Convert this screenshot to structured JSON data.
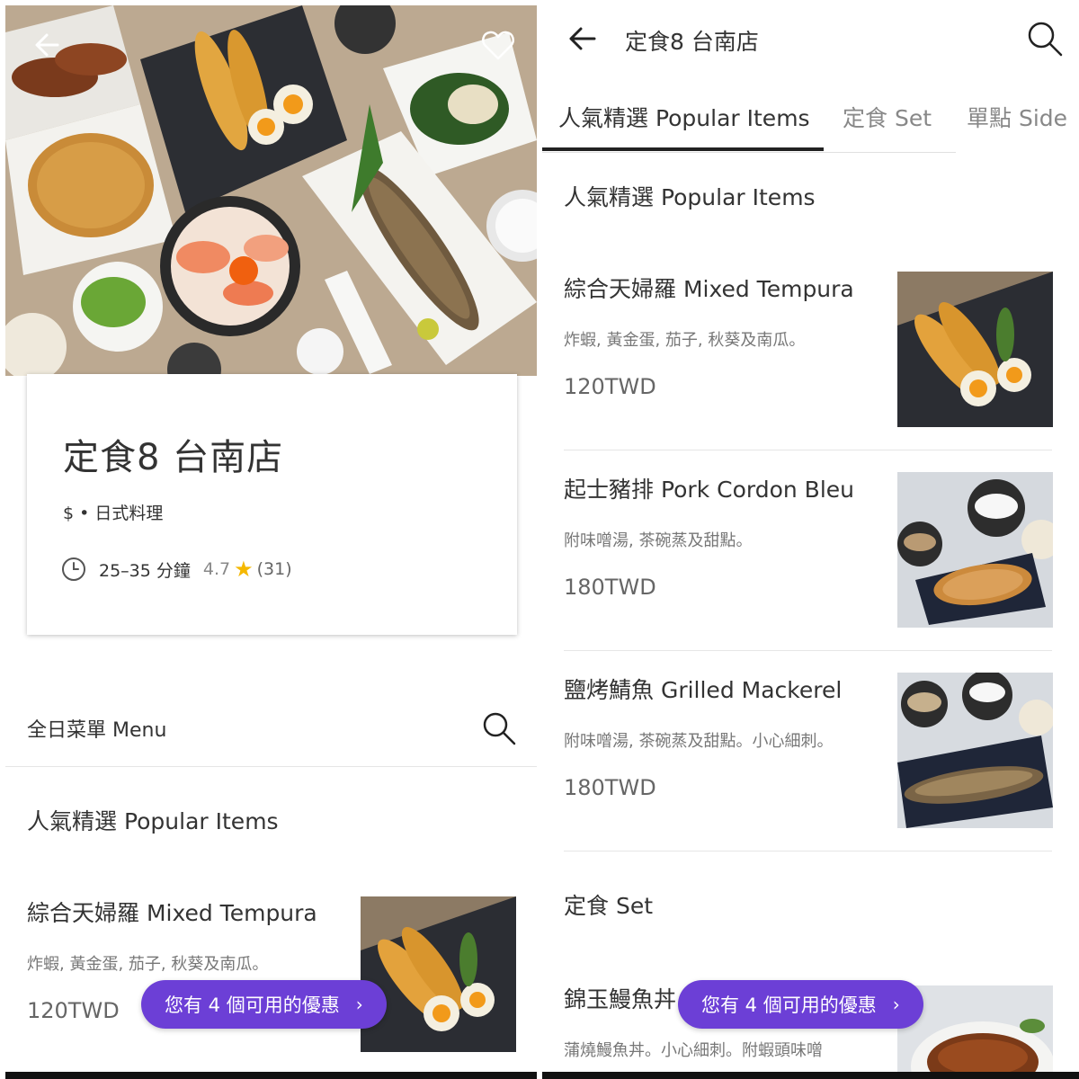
{
  "left": {
    "store": {
      "title": "定食8 台南店",
      "meta": "$ • 日式料理",
      "eta": "25–35 分鐘",
      "rating": "4.7",
      "reviews": "(31)"
    },
    "menu": {
      "label": "全日菜單 Menu"
    },
    "section_title": "人氣精選 Popular Items",
    "items": [
      {
        "name": "綜合天婦羅 Mixed Tempura",
        "desc": "炸蝦, 黃金蛋, 茄子, 秋葵及南瓜。",
        "price": "120TWD"
      }
    ],
    "promo": {
      "label": "您有 4 個可用的優惠",
      "chevron": "›"
    }
  },
  "right": {
    "header": {
      "title": "定食8 台南店"
    },
    "tabs": [
      {
        "label": "人氣精選 Popular Items",
        "active": true
      },
      {
        "label": "定食 Set",
        "active": false
      },
      {
        "label": "單點 Side",
        "active": false
      }
    ],
    "sections": [
      {
        "title": "人氣精選 Popular Items"
      },
      {
        "title": "定食 Set"
      }
    ],
    "items": [
      {
        "name": "綜合天婦羅 Mixed Tempura",
        "desc": "炸蝦, 黃金蛋, 茄子, 秋葵及南瓜。",
        "price": "120TWD"
      },
      {
        "name": "起士豬排 Pork Cordon Bleu",
        "desc": "附味噌湯, 茶碗蒸及甜點。",
        "price": "180TWD"
      },
      {
        "name": "鹽烤鯖魚 Grilled Mackerel",
        "desc": "附味噌湯, 茶碗蒸及甜點。小心細刺。",
        "price": "180TWD"
      },
      {
        "name": "錦玉鰻魚丼",
        "desc": "蒲燒鰻魚丼。小心細刺。附蝦頭味噌"
      }
    ],
    "promo": {
      "label": "您有 4 個可用的優惠",
      "chevron": "›"
    }
  },
  "colors": {
    "accent": "#6c3fd6",
    "star": "#f5b800",
    "text": "#333333",
    "muted": "#777777"
  },
  "icons": [
    "back-arrow-icon",
    "heart-icon",
    "clock-icon",
    "star-icon",
    "search-icon",
    "chevron-right-icon"
  ]
}
